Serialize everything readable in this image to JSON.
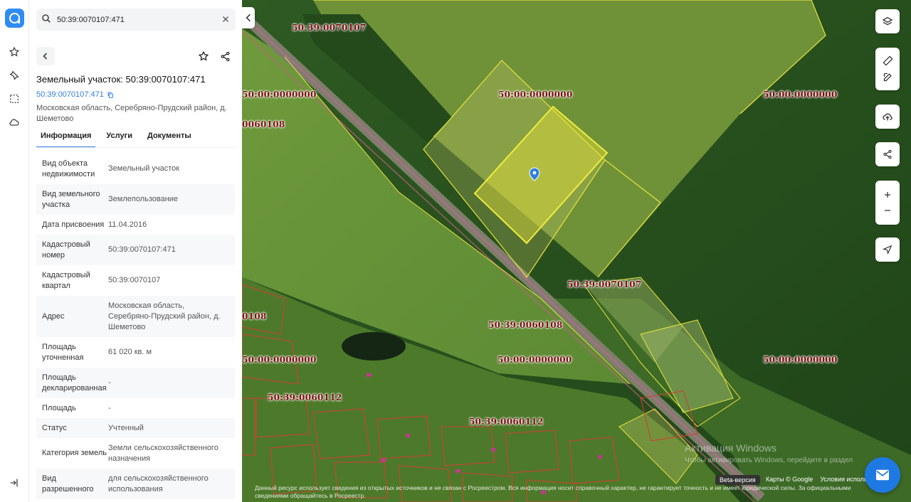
{
  "search": {
    "value": "50:39:0070107:471"
  },
  "panel": {
    "title": "Земельный участок: 50:39:0070107:471",
    "link": "50:39:0070107:471",
    "address": "Московская область, Серебряно-Прудский район, д. Шеметово",
    "tabs": [
      "Информация",
      "Услуги",
      "Документы"
    ],
    "rows": [
      {
        "k": "Вид объекта недвижимости",
        "v": "Земельный участок"
      },
      {
        "k": "Вид земельного участка",
        "v": "Землепользование"
      },
      {
        "k": "Дата присвоения",
        "v": "11.04.2016"
      },
      {
        "k": "Кадастровый номер",
        "v": "50:39:0070107:471"
      },
      {
        "k": "Кадастровый квартал",
        "v": "50:39:0070107"
      },
      {
        "k": "Адрес",
        "v": "Московская область, Серебряно-Прудский район, д. Шеметово"
      },
      {
        "k": "Площадь уточненная",
        "v": "61 020 кв. м"
      },
      {
        "k": "Площадь декларированная",
        "v": "-"
      },
      {
        "k": "Площадь",
        "v": "-"
      },
      {
        "k": "Статус",
        "v": "Учтенный"
      },
      {
        "k": "Категория земель",
        "v": "Земли сельскохозяйственного назначения"
      },
      {
        "k": "Вид разрешенного",
        "v": "для сельскохозяйственного использования"
      }
    ]
  },
  "map": {
    "labels": [
      "50:39:0070107",
      "50:00:0000000",
      "50:00:0000000",
      "0060108",
      "50:00:0000000",
      "50:39:0070107",
      "0108",
      "50:39:0060108",
      "50:00:0000000",
      "50:00:0000000",
      "50:00:0000000",
      "50:39:0060112",
      "50:39:0060112"
    ],
    "beta": "Beta-версия",
    "attribution": [
      "Карты © Google",
      "Условия использования"
    ],
    "disclaimer": "Данный ресурс использует сведения из открытых источников и не связан с Росреестром. Вся информация носит справочный характер, не гарантирует точность и не имеет юридической силы. За официальными сведениями обращайтесь в Росреестр.",
    "watermark": "Активация Windows",
    "watermark_sub": "Чтобы активировать Windows, перейдите в раздел"
  },
  "colors": {
    "accent": "#2f7fe0",
    "parcel": "#e8e23a",
    "cadastre": "#7a1010"
  }
}
